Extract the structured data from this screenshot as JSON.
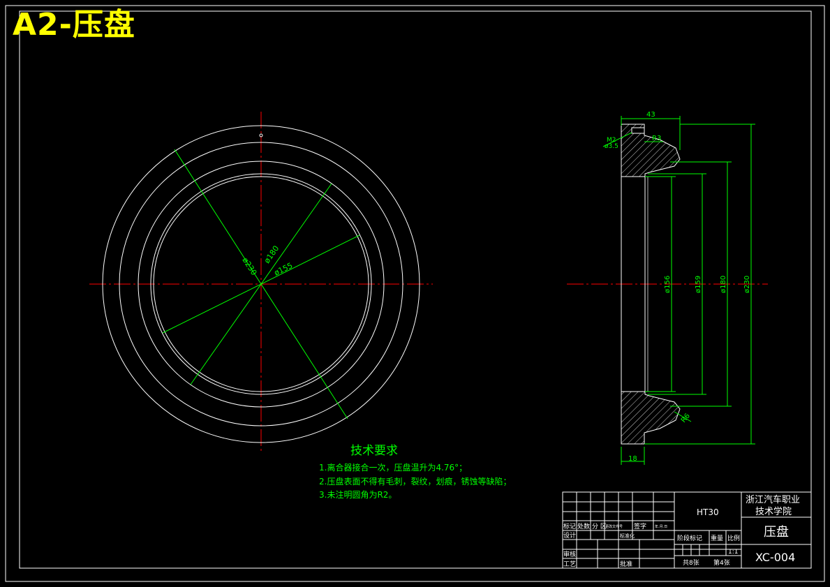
{
  "sheet_title": "A2-压盘",
  "colors": {
    "background": "#000000",
    "outline": "#ffffff",
    "dimension": "#00ff00",
    "centerline": "#ff0000",
    "title": "#ffff00",
    "text": "#00ff00"
  },
  "front_view": {
    "dim_230": "ø230",
    "dim_180": "ø180",
    "dim_155": "ø155"
  },
  "section_view": {
    "dim_43": "43",
    "dim_18": "18",
    "dim_r3": "R3",
    "dim_m2": "M2",
    "dim_m2_depth": "ø3.5",
    "dim_r6": "R6",
    "dim_d156": "ø156",
    "dim_d159": "ø159",
    "dim_d180": "ø180",
    "dim_d230": "ø230"
  },
  "tech_requirements": {
    "heading": "技术要求",
    "items": [
      "1.离合器接合一次，压盘温升为4.76°；",
      "2.压盘表面不得有毛刺，裂纹，划痕，锈蚀等缺陷；",
      "3.未注明圆角为R2。"
    ]
  },
  "title_block": {
    "material": "HT30",
    "school_line1": "浙江汽车职业",
    "school_line2": "技术学院",
    "part_name": "压盘",
    "drawing_no": "XC-004",
    "label_mark": "标记",
    "label_count": "处数",
    "label_zone": "分 区",
    "label_docno": "更改文件号",
    "label_sign": "签字",
    "label_date": "年.月.日",
    "label_design": "设计",
    "label_standard": "标准化",
    "label_review": "审核",
    "label_craft": "工艺",
    "label_approve": "批准",
    "label_stage": "阶段标记",
    "label_weight": "重量",
    "label_scale": "比例",
    "scale": "1:1",
    "sheets_total": "共8张",
    "sheet_no": "第4张"
  }
}
